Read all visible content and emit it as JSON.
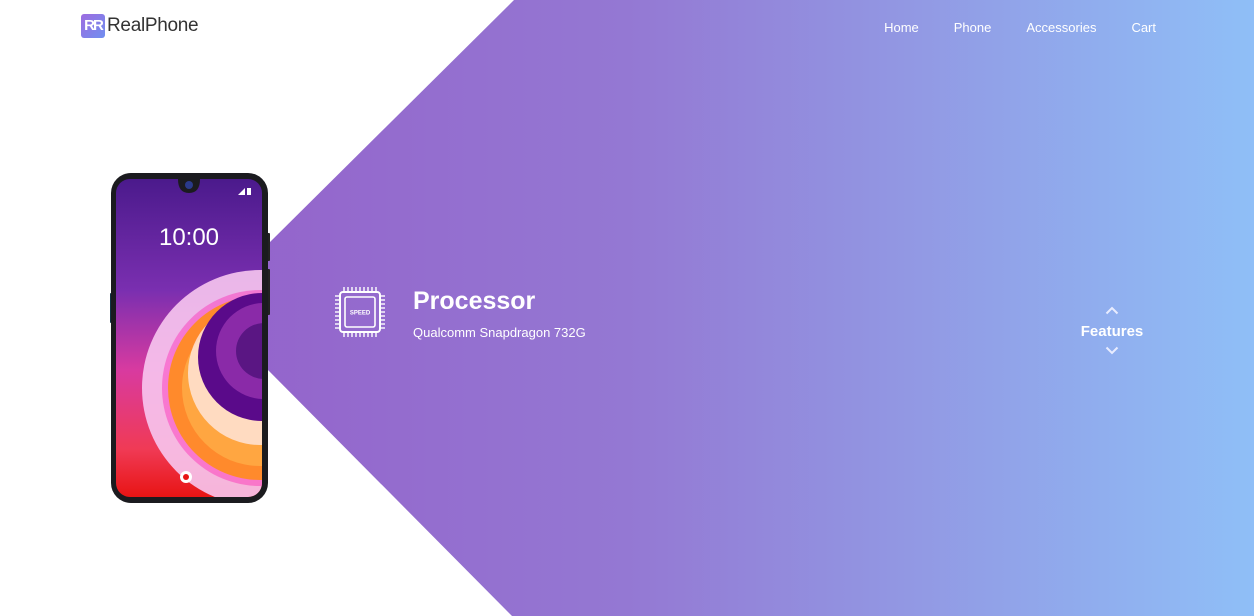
{
  "brand": {
    "logo_mark": "R",
    "name": "RealPhone"
  },
  "nav": {
    "items": [
      "Home",
      "Phone",
      "Accessories",
      "Cart"
    ]
  },
  "phone_screen": {
    "time": "10:00"
  },
  "feature": {
    "icon": "cpu-chip-icon",
    "icon_text": "SPEED",
    "title": "Processor",
    "description": "Qualcomm Snapdragon 732G"
  },
  "features_nav": {
    "label": "Features",
    "up_icon": "chevron-up-icon",
    "down_icon": "chevron-down-icon"
  },
  "colors": {
    "gradient_start": "#9357c6",
    "gradient_mid": "#9478d3",
    "gradient_end": "#8fbff7"
  }
}
